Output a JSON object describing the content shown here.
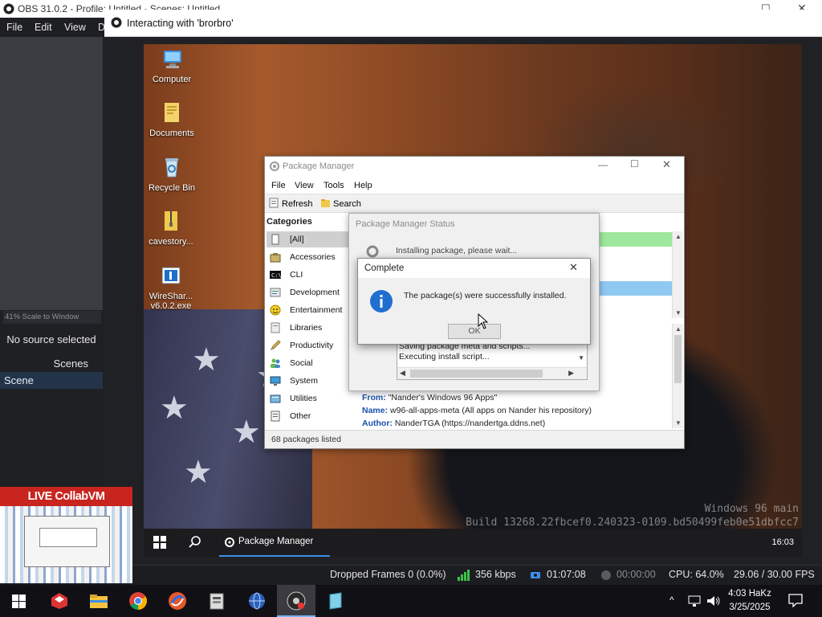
{
  "obs": {
    "title": "OBS 31.0.2 - Profile: Untitled - Scenes: Untitled",
    "menu": [
      "File",
      "Edit",
      "View",
      "D"
    ],
    "scale_label": "41% Scale to Window",
    "no_source": "No source selected",
    "scenes_header": "Scenes",
    "scene_item": "Scene",
    "status": {
      "dropped": "Dropped Frames 0 (0.0%)",
      "kbps": "356 kbps",
      "stream_time": "01:07:08",
      "rec_time": "00:00:00",
      "cpu": "CPU: 64.0%",
      "fps": "29.06 / 30.00 FPS"
    }
  },
  "projector": {
    "title": "Interacting with 'brorbro'"
  },
  "vm": {
    "desktop_icons": [
      {
        "label": "Computer"
      },
      {
        "label": "Documents"
      },
      {
        "label": "Recycle Bin"
      },
      {
        "label": "cavestory..."
      },
      {
        "label": "WireShar...\nv6.0.2.exe"
      }
    ],
    "watermark_line1": "Windows 96 main",
    "watermark_line2": "Build 13268.22fbcef0.240323-0109.bd50499feb0e51dbfcc7",
    "taskbar": {
      "task_label": "Package Manager",
      "clock": "16:03"
    },
    "package_manager": {
      "title": "Package Manager",
      "menu": [
        "File",
        "View",
        "Tools",
        "Help"
      ],
      "toolbar": {
        "refresh": "Refresh",
        "search": "Search"
      },
      "categories_header": "Categories",
      "categories": [
        "[All]",
        "Accessories",
        "CLI",
        "Development",
        "Entertainment",
        "Libraries",
        "Productivity",
        "Social",
        "System",
        "Utilities",
        "Other"
      ],
      "details": {
        "from_label": "From:",
        "from_value": "\"Nander's Windows 96 Apps\"",
        "name_label": "Name:",
        "name_value": "w96-all-apps-meta (All apps on Nander his repository)",
        "author_label": "Author:",
        "author_value": "NanderTGA (https://nandertga.ddns.net)"
      },
      "status": "68 packages listed"
    },
    "status_dialog": {
      "title": "Package Manager Status",
      "message": "Installing package, please wait...",
      "log": [
        "Saving package meta and scripts...",
        "Executing install script..."
      ]
    },
    "complete_dialog": {
      "title": "Complete",
      "message": "The package(s) were successfully installed.",
      "ok": "OK"
    }
  },
  "thumbnail": {
    "banner": "LIVE CollabVM REACTION"
  },
  "host": {
    "clock_time": "4:03 HaKz",
    "clock_date": "3/25/2025"
  },
  "colors": {
    "obs_bg": "#1f2024",
    "accent_blue": "#3b8fe8",
    "green_row": "#9ee89e",
    "banner_red": "#c8251f"
  }
}
